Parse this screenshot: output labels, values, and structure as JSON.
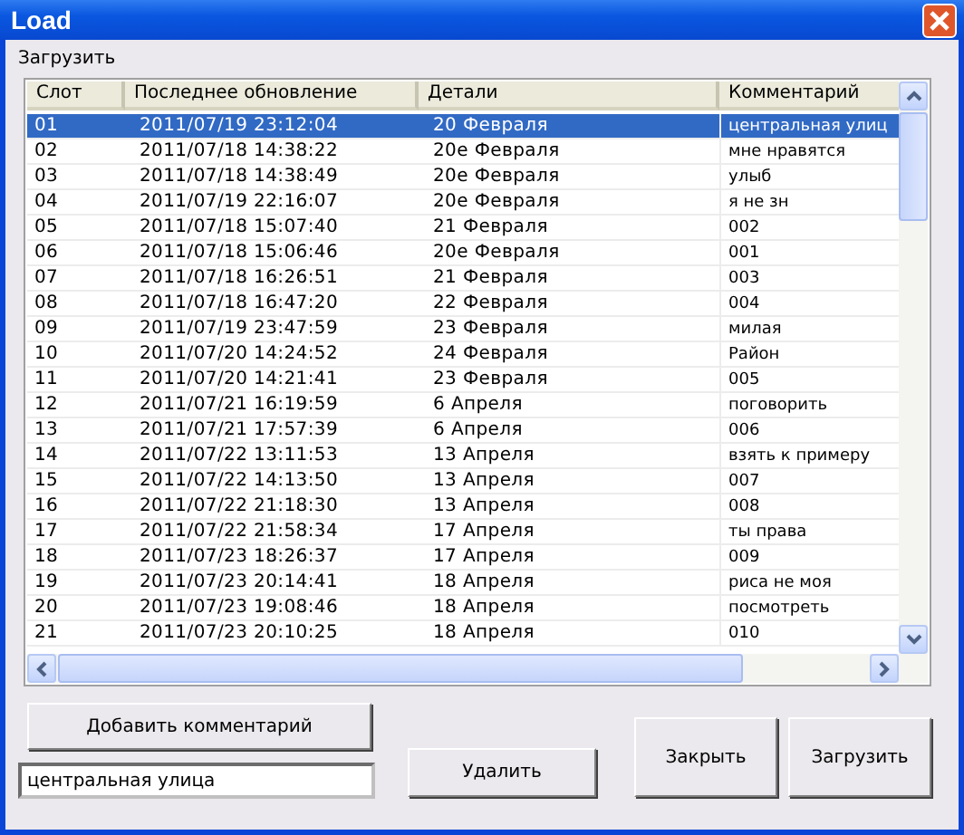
{
  "window": {
    "title": "Load"
  },
  "group_label": "Загрузить",
  "table": {
    "columns": [
      "Слот",
      "Последнее обновление",
      "Детали",
      "Комментарий"
    ],
    "rows": [
      {
        "cells": [
          "01",
          "2011/07/19 23:12:04",
          "20 Февраля",
          "центральная улиц"
        ],
        "selected": true
      },
      {
        "cells": [
          "02",
          "2011/07/18 14:38:22",
          "20е Февраля",
          "мне нравятся"
        ],
        "selected": false
      },
      {
        "cells": [
          "03",
          "2011/07/18 14:38:49",
          "20е Февраля",
          "улыб"
        ],
        "selected": false
      },
      {
        "cells": [
          "04",
          "2011/07/19 22:16:07",
          "20е Февраля",
          "я не зн"
        ],
        "selected": false
      },
      {
        "cells": [
          "05",
          "2011/07/18 15:07:40",
          "21 Февраля",
          "002"
        ],
        "selected": false
      },
      {
        "cells": [
          "06",
          "2011/07/18 15:06:46",
          "20е Февраля",
          "001"
        ],
        "selected": false
      },
      {
        "cells": [
          "07",
          "2011/07/18 16:26:51",
          "21 Февраля",
          "003"
        ],
        "selected": false
      },
      {
        "cells": [
          "08",
          "2011/07/18 16:47:20",
          "22 Февраля",
          "004"
        ],
        "selected": false
      },
      {
        "cells": [
          "09",
          "2011/07/19 23:47:59",
          "23 Февраля",
          "милая"
        ],
        "selected": false
      },
      {
        "cells": [
          "10",
          "2011/07/20 14:24:52",
          "24 Февраля",
          "Район"
        ],
        "selected": false
      },
      {
        "cells": [
          "11",
          "2011/07/20 14:21:41",
          "23 Февраля",
          "005"
        ],
        "selected": false
      },
      {
        "cells": [
          "12",
          "2011/07/21 16:19:59",
          "6 Апреля",
          "поговорить"
        ],
        "selected": false
      },
      {
        "cells": [
          "13",
          "2011/07/21 17:57:39",
          "6 Апреля",
          "006"
        ],
        "selected": false
      },
      {
        "cells": [
          "14",
          "2011/07/22 13:11:53",
          "13 Апреля",
          "взять к примеру"
        ],
        "selected": false
      },
      {
        "cells": [
          "15",
          "2011/07/22 14:13:50",
          "13 Апреля",
          "007"
        ],
        "selected": false
      },
      {
        "cells": [
          "16",
          "2011/07/22 21:18:30",
          "13 Апреля",
          "008"
        ],
        "selected": false
      },
      {
        "cells": [
          "17",
          "2011/07/22 21:58:34",
          "17 Апреля",
          "ты права"
        ],
        "selected": false
      },
      {
        "cells": [
          "18",
          "2011/07/23 18:26:37",
          "17 Апреля",
          "009"
        ],
        "selected": false
      },
      {
        "cells": [
          "19",
          "2011/07/23 20:14:41",
          "18 Апреля",
          "риса не моя"
        ],
        "selected": false
      },
      {
        "cells": [
          "20",
          "2011/07/23 19:08:46",
          "18 Апреля",
          "посмотреть"
        ],
        "selected": false
      },
      {
        "cells": [
          "21",
          "2011/07/23 20:10:25",
          "18 Апреля",
          "010"
        ],
        "selected": false
      }
    ]
  },
  "add_comment_button": "Добавить комментарий",
  "comment_field": {
    "value": "центральная улица"
  },
  "delete_button": "Удалить",
  "close_button": "Закрыть",
  "load_button": "Загрузить"
}
